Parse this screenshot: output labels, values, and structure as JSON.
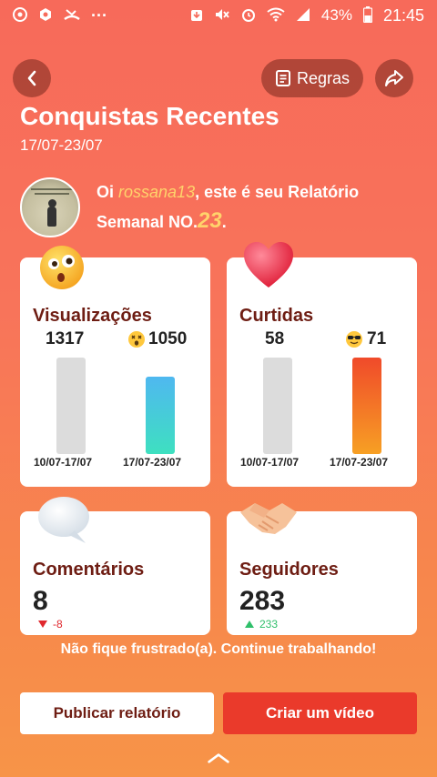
{
  "status_bar": {
    "battery": "43%",
    "time": "21:45",
    "dots": "···"
  },
  "header": {
    "rules_label": "Regras",
    "title": "Conquistas Recentes",
    "date_range": "17/07-23/07"
  },
  "greeting": {
    "prefix": "Oi ",
    "username": "rossana13",
    "middle": ", este é seu Relatório Semanal NO.",
    "report_number": "23",
    "suffix": "."
  },
  "views_card": {
    "title": "Visualizações",
    "prev_value": "1317",
    "curr_value": "1050",
    "prev_label": "10/07-17/07",
    "curr_label": "17/07-23/07",
    "prev_fraction": 1.0,
    "curr_fraction": 0.8
  },
  "likes_card": {
    "title": "Curtidas",
    "prev_value": "58",
    "curr_value": "71",
    "prev_label": "10/07-17/07",
    "curr_label": "17/07-23/07",
    "prev_fraction": 1.0,
    "curr_fraction": 1.0
  },
  "comments_card": {
    "title": "Comentários",
    "value": "8",
    "delta": "-8",
    "delta_direction": "down"
  },
  "followers_card": {
    "title": "Seguidores",
    "value": "283",
    "delta": "233",
    "delta_direction": "up"
  },
  "motivation": "Não fique frustrado(a). Continue trabalhando!",
  "actions": {
    "publish_label": "Publicar relatório",
    "create_video_label": "Criar um vídeo"
  },
  "colors": {
    "accent": "#ea3a2b",
    "title_dark_red": "#6e1d13",
    "highlight_yellow": "#ffd36b",
    "bar_grey": "#dcdcdc",
    "views_bar_top": "#4fb8f0",
    "views_bar_bottom": "#3ee0c0",
    "likes_bar_top": "#f04a2a",
    "likes_bar_bottom": "#f7a024",
    "delta_down": "#e0282e",
    "delta_up": "#2fbf6a"
  }
}
